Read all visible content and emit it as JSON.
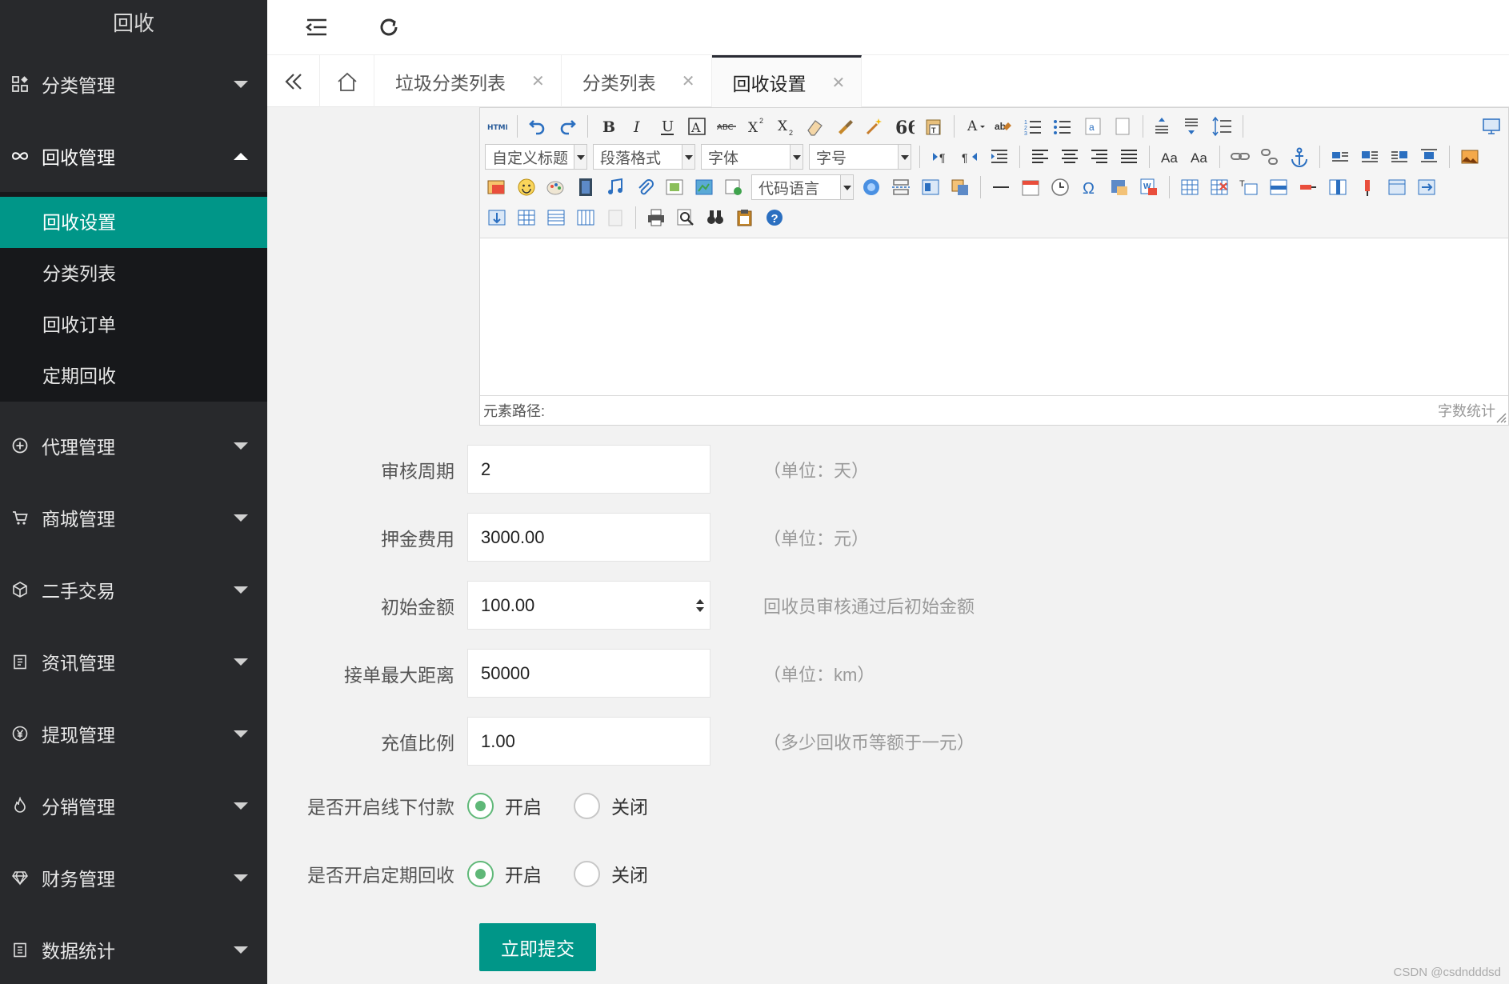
{
  "app": {
    "title": "回收"
  },
  "sidebar": {
    "groups": [
      {
        "label": "分类管理",
        "icon": "grid-icon",
        "expanded": false
      },
      {
        "label": "回收管理",
        "icon": "infinity-icon",
        "expanded": true,
        "items": [
          {
            "label": "回收设置",
            "active": true
          },
          {
            "label": "分类列表",
            "active": false
          },
          {
            "label": "回收订单",
            "active": false
          },
          {
            "label": "定期回收",
            "active": false
          }
        ]
      },
      {
        "label": "代理管理",
        "icon": "plus-circle-icon",
        "expanded": false
      },
      {
        "label": "商城管理",
        "icon": "cart-icon",
        "expanded": false
      },
      {
        "label": "二手交易",
        "icon": "cube-icon",
        "expanded": false
      },
      {
        "label": "资讯管理",
        "icon": "clipboard-icon",
        "expanded": false
      },
      {
        "label": "提现管理",
        "icon": "yen-icon",
        "expanded": false
      },
      {
        "label": "分销管理",
        "icon": "fire-icon",
        "expanded": false
      },
      {
        "label": "财务管理",
        "icon": "diamond-icon",
        "expanded": false
      },
      {
        "label": "数据统计",
        "icon": "report-icon",
        "expanded": false
      }
    ]
  },
  "header": {
    "menu_icon": "fold-menu-icon",
    "refresh_icon": "refresh-icon"
  },
  "tabs": [
    {
      "label": "垃圾分类列表",
      "active": false
    },
    {
      "label": "分类列表",
      "active": false
    },
    {
      "label": "回收设置",
      "active": true
    }
  ],
  "editor": {
    "combos": {
      "heading": "自定义标题",
      "paragraph": "段落格式",
      "font": "字体",
      "size": "字号",
      "code": "代码语言"
    },
    "path_label": "元素路径:",
    "word_count": "字数统计"
  },
  "form": {
    "fields": [
      {
        "label": "审核周期",
        "value": "2",
        "note": "（单位：天）"
      },
      {
        "label": "押金费用",
        "value": "3000.00",
        "note": "（单位：元）"
      },
      {
        "label": "初始金额",
        "value": "100.00",
        "note": "回收员审核通过后初始金额"
      },
      {
        "label": "接单最大距离",
        "value": "50000",
        "note": "（单位：km）"
      },
      {
        "label": "充值比例",
        "value": "1.00",
        "note": "（多少回收币等额于一元）"
      }
    ],
    "radios": [
      {
        "label": "是否开启线下付款",
        "options": [
          "开启",
          "关闭"
        ],
        "selected": "开启"
      },
      {
        "label": "是否开启定期回收",
        "options": [
          "开启",
          "关闭"
        ],
        "selected": "开启"
      }
    ],
    "submit": "立即提交"
  },
  "colors": {
    "accent": "#009688",
    "sidebar": "#28292c",
    "radio_on": "#5fb878"
  },
  "watermark": "CSDN @csdndddsd"
}
